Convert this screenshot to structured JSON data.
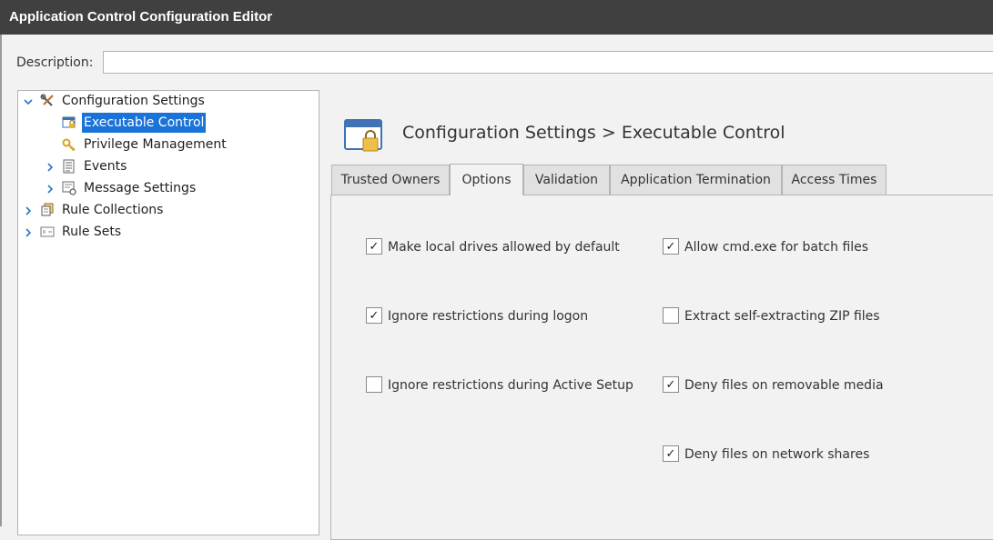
{
  "window": {
    "title": "Application Control Configuration Editor"
  },
  "description": {
    "label": "Description:",
    "value": "",
    "placeholder": ""
  },
  "tree": {
    "nodes": [
      {
        "label": "Configuration Settings",
        "expanded": true,
        "icon": "tools-icon"
      },
      {
        "label": "Executable Control",
        "selected": true,
        "icon": "window-lock-icon"
      },
      {
        "label": "Privilege Management",
        "icon": "key-icon"
      },
      {
        "label": "Events",
        "expanded": false,
        "icon": "list-icon"
      },
      {
        "label": "Message Settings",
        "expanded": false,
        "icon": "message-icon"
      },
      {
        "label": "Rule Collections",
        "expanded": false,
        "icon": "collection-icon"
      },
      {
        "label": "Rule Sets",
        "expanded": false,
        "icon": "ruleset-icon"
      }
    ]
  },
  "header": {
    "breadcrumb": "Configuration Settings > Executable Control",
    "icon": "window-lock-icon"
  },
  "tabs": [
    {
      "label": "Trusted Owners"
    },
    {
      "label": "Options",
      "active": true
    },
    {
      "label": "Validation"
    },
    {
      "label": "Application Termination"
    },
    {
      "label": "Access Times"
    }
  ],
  "options": {
    "left": [
      {
        "label": "Make local drives allowed by default",
        "checked": true
      },
      {
        "label": "Ignore restrictions during logon",
        "checked": true
      },
      {
        "label": "Ignore restrictions during Active Setup",
        "checked": false
      }
    ],
    "right": [
      {
        "label": "Allow cmd.exe for batch files",
        "checked": true
      },
      {
        "label": "Extract self-extracting ZIP files",
        "checked": false
      },
      {
        "label": "Deny files on removable media",
        "checked": true
      },
      {
        "label": "Deny files on network shares",
        "checked": true
      }
    ]
  },
  "colors": {
    "titlebar": "#404040",
    "selection": "#1a73d9",
    "expander": "#2a73c9"
  }
}
